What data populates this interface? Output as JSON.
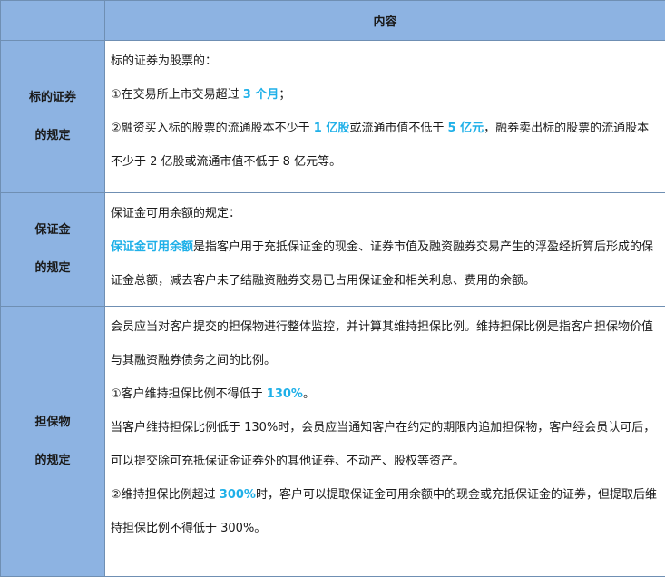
{
  "header": {
    "left": "",
    "right": "内容"
  },
  "sections": [
    {
      "label_line1": "标的证券",
      "label_line2": "的规定",
      "p1": "标的证券为股票的：",
      "p2_a": "①在交易所上市交易超过 ",
      "p2_hl": "3 个月",
      "p2_b": "；",
      "p3_a": "②融资买入标的股票的流通股本不少于 ",
      "p3_hl1": "1 亿股",
      "p3_b": "或流通市值不低于 ",
      "p3_hl2": "5 亿元",
      "p3_c": "，融券卖出标的股票的流通股本不少于 2 亿股或流通市值不低于 8 亿元等。"
    },
    {
      "label_line1": "保证金",
      "label_line2": "的规定",
      "p1": "保证金可用余额的规定：",
      "p2_hl": "保证金可用余额",
      "p2_b": "是指客户用于充抵保证金的现金、证券市值及融资融券交易产生的浮盈经折算后形成的保证金总额，减去客户未了结融资融券交易已占用保证金和相关利息、费用的余额。"
    },
    {
      "label_line1": "担保物",
      "label_line2": "的规定",
      "p1": "会员应当对客户提交的担保物进行整体监控，并计算其维持担保比例。维持担保比例是指客户担保物价值与其融资融券债务之间的比例。",
      "p2_a": "①客户维持担保比例不得低于 ",
      "p2_hl": "130%",
      "p2_b": "。",
      "p3": "当客户维持担保比例低于 130%时，会员应当通知客户在约定的期限内追加担保物，客户经会员认可后，可以提交除可充抵保证金证券外的其他证券、不动产、股权等资产。",
      "p4_a": "②维持担保比例超过 ",
      "p4_hl": "300%",
      "p4_b": "时，客户可以提取保证金可用余额中的现金或充抵保证金的证券，但提取后维持担保比例不得低于 300%。"
    }
  ],
  "colors": {
    "label_bg": "#8db3e2",
    "highlight": "#1fb0e8",
    "border": "#6f8fb3"
  }
}
